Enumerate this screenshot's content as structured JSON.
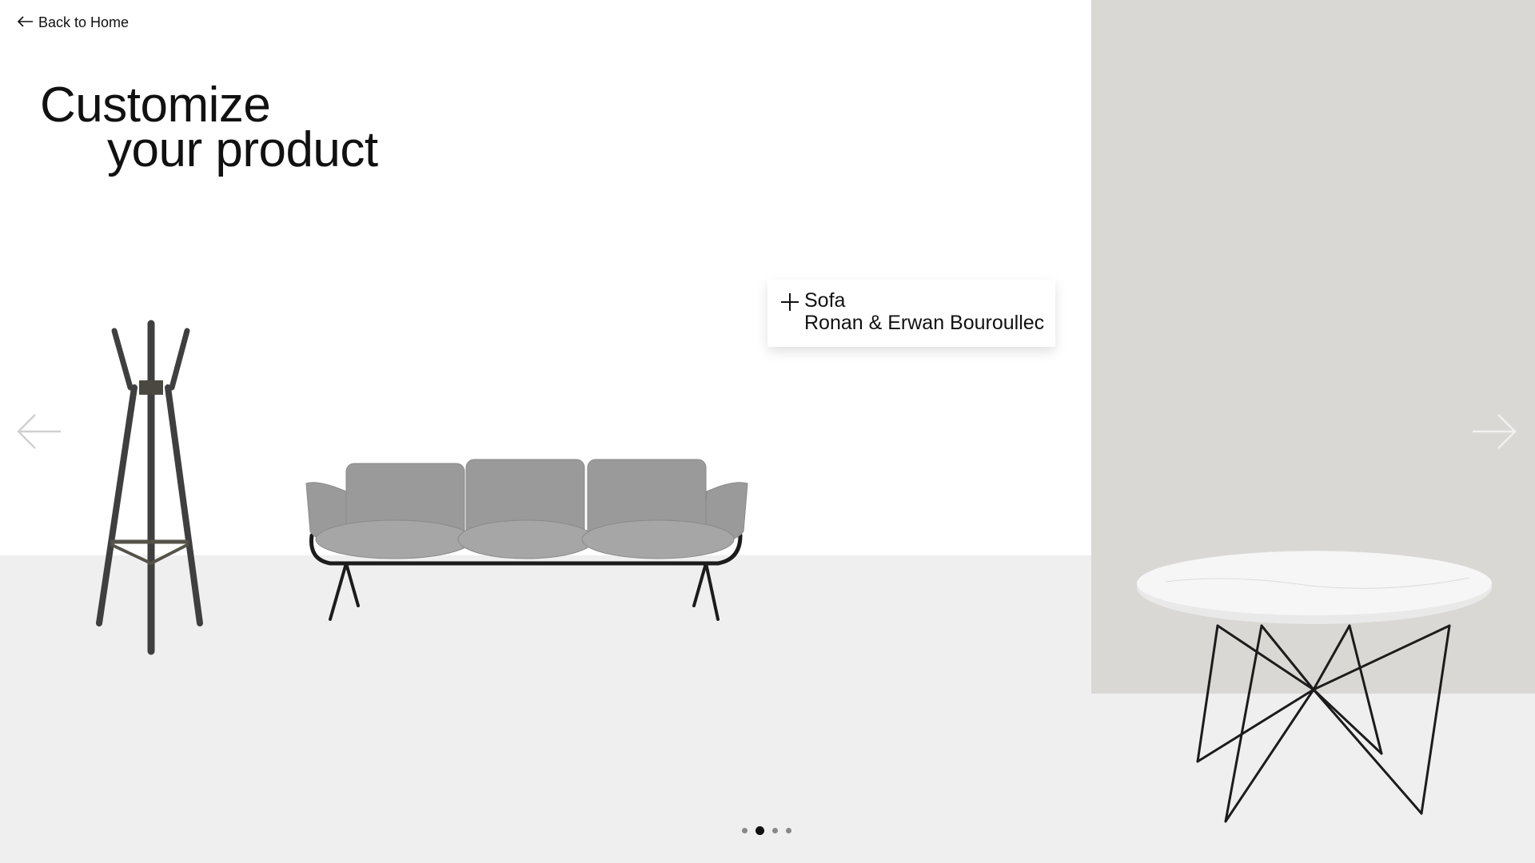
{
  "header": {
    "back_label": "Back to Home"
  },
  "hero": {
    "line1": "Customize",
    "line2": "your product"
  },
  "products": [
    {
      "name": "coat stand"
    },
    {
      "name": "sofa"
    },
    {
      "name": "marble table"
    }
  ],
  "tooltip": {
    "title": "Sofa",
    "designer": "Ronan & Erwan Bouroullec"
  },
  "carousel": {
    "dots": 4,
    "active_index": 1
  },
  "colors": {
    "wall_right": "#d9d8d4",
    "floor": "#efefef",
    "text": "#111111",
    "sofa": "#9a9a9a"
  }
}
